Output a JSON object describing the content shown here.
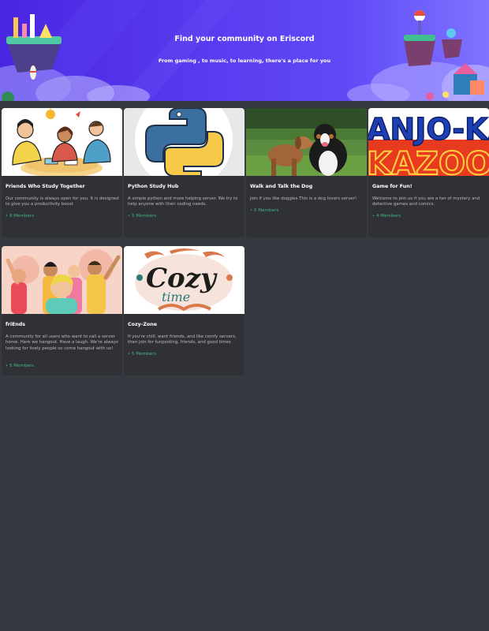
{
  "hero": {
    "title": "Find your community on Eriscord",
    "subtitle": "From gaming , to music, to learning, there's a place for you"
  },
  "member_dot": "•",
  "communities": [
    {
      "name": "Friends Who Study Together",
      "description": "Our community is always open for you. It is designed to give you a productivity boost",
      "members": "8 Members",
      "banner_icon": "study-friends-illustration"
    },
    {
      "name": "Python Study Hub",
      "description": "A simple python and more helping server. We try to help anyone with their coding needs.",
      "members": "5 Members",
      "banner_icon": "python-logo"
    },
    {
      "name": "Walk and Talk the Dog",
      "description": "Join if you like doggies.This is a dog lovers server!",
      "members": "5 Members",
      "banner_icon": "dogs-photo"
    },
    {
      "name": "Game for Fun!",
      "description": "Welcome to join us if you are a fan of mystery and detective games and comics.",
      "members": "4 Members",
      "banner_icon": "banjo-kazooie-logo",
      "banner_text": "ANJO-KAZOO"
    },
    {
      "name": "friEnds",
      "description": "A community for all users who want to call a server home. Here we hangout. Have a laugh. We're always looking for lively people so come hangout with us!",
      "members": "5 Members",
      "banner_icon": "friends-selfie-illustration"
    },
    {
      "name": "Cozy-Zone",
      "description": "If you're chill, want friends, and like comfy servers, then join for funposting, friends, and good times",
      "members": "5 Members",
      "banner_icon": "cozy-time-lettering",
      "banner_text_1": "Cozy",
      "banner_text_2": "time"
    }
  ],
  "colors": {
    "background": "#36393f",
    "card": "#2f3136",
    "hero_start": "#4a25e1",
    "hero_end": "#7f73ff",
    "members_green": "#43b581"
  }
}
